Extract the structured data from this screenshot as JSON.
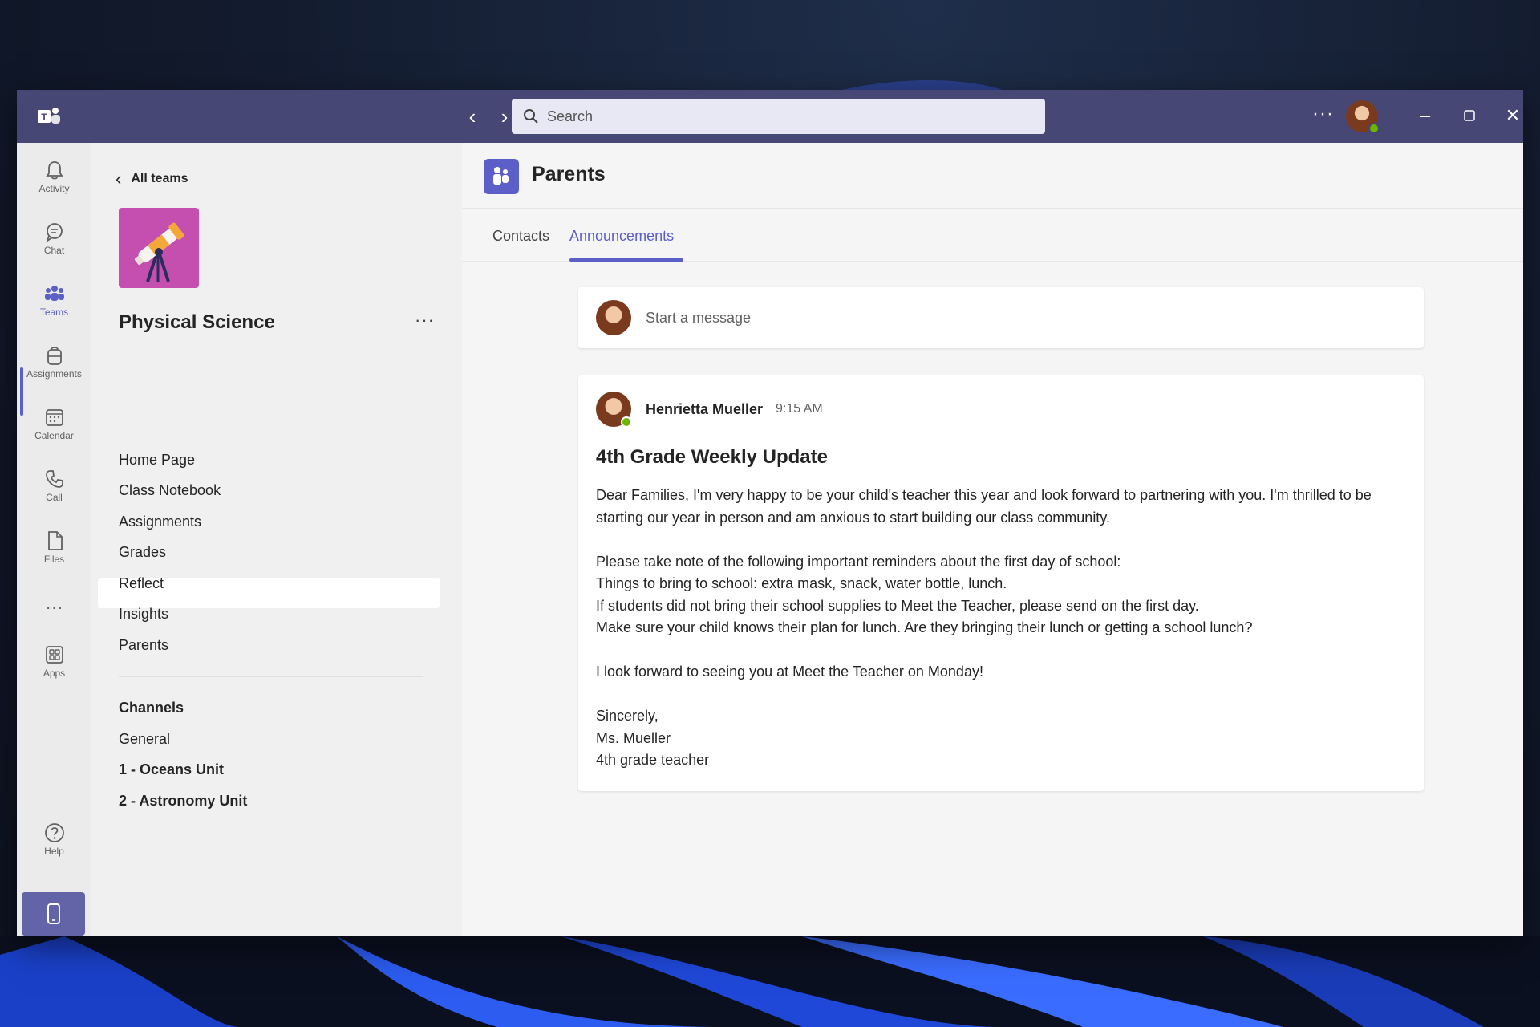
{
  "search": {
    "placeholder": "Search"
  },
  "titlebar": {
    "more": "···"
  },
  "rail": {
    "items": [
      {
        "label": "Activity",
        "icon": "bell-icon"
      },
      {
        "label": "Chat",
        "icon": "chat-icon"
      },
      {
        "label": "Teams",
        "icon": "teams-icon",
        "active": true
      },
      {
        "label": "Assignments",
        "icon": "backpack-icon"
      },
      {
        "label": "Calendar",
        "icon": "calendar-icon"
      },
      {
        "label": "Call",
        "icon": "phone-icon"
      },
      {
        "label": "Files",
        "icon": "file-icon"
      },
      {
        "label": "Apps",
        "icon": "apps-icon"
      },
      {
        "label": "Help",
        "icon": "help-icon"
      }
    ],
    "more": "···"
  },
  "teampanel": {
    "back": "All teams",
    "team_name": "Physical Science",
    "more": "···",
    "items": [
      "Home Page",
      "Class Notebook",
      "Assignments",
      "Grades",
      "Reflect",
      "Insights",
      "Parents"
    ],
    "selected": "Parents",
    "channels_heading": "Channels",
    "channels": [
      {
        "label": "General",
        "bold": false
      },
      {
        "label": "1 - Oceans Unit",
        "bold": true
      },
      {
        "label": "2 - Astronomy Unit",
        "bold": true
      }
    ]
  },
  "main": {
    "channel_title": "Parents",
    "tabs": [
      "Contacts",
      "Announcements"
    ],
    "active_tab": "Announcements",
    "compose_placeholder": "Start a message",
    "post": {
      "author": "Henrietta Mueller",
      "time": "9:15 AM",
      "title": "4th Grade Weekly Update",
      "paragraphs": [
        "Dear Families, I'm very happy to be your child's teacher this year and look forward to partnering with you. I'm thrilled to be starting our year in person and am anxious to start building our class community.",
        "Please take note of the following important reminders about the first day of school:",
        "Things to bring to school: extra mask, snack, water bottle, lunch.",
        "If students did not bring their school supplies to Meet the Teacher, please send on the first day.",
        "Make sure your child knows their plan for lunch. Are they bringing their lunch or getting a school lunch?",
        "I look forward to seeing you at Meet the Teacher on Monday!",
        "Sincerely,",
        "Ms. Mueller",
        "4th grade teacher"
      ]
    }
  },
  "colors": {
    "titlebar": "#464775",
    "accent": "#5b5fc7",
    "team_tile": "#c44fae",
    "presence": "#6bb700"
  }
}
